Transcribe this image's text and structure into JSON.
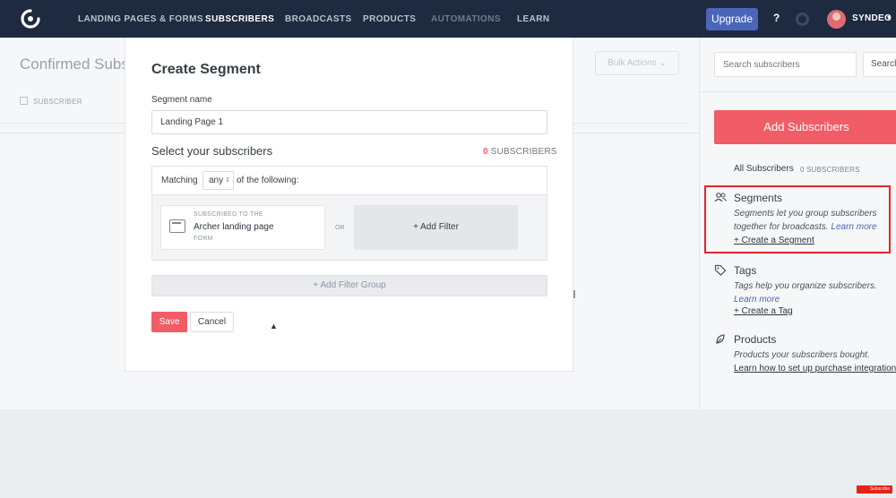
{
  "nav": {
    "items": [
      {
        "label": "LANDING PAGES & FORMS",
        "state": "normal"
      },
      {
        "label": "SUBSCRIBERS",
        "state": "active"
      },
      {
        "label": "BROADCASTS",
        "state": "normal"
      },
      {
        "label": "PRODUCTS",
        "state": "normal"
      },
      {
        "label": "AUTOMATIONS",
        "state": "dim"
      },
      {
        "label": "LEARN",
        "state": "normal"
      }
    ],
    "upgrade_label": "Upgrade",
    "help_label": "?",
    "user_name": "SYNDEO",
    "user_caret": "▾"
  },
  "page": {
    "title": "Confirmed Subs",
    "bulk_actions": "Bulk Actions ⌄",
    "column_subscriber": "SUBSCRIBER"
  },
  "sidebar": {
    "search_placeholder": "Search subscribers",
    "search_button": "Search",
    "add_subscribers": "Add Subscribers",
    "all_subscribers": "All Subscribers",
    "all_subscribers_count": "0 SUBSCRIBERS",
    "segments": {
      "title": "Segments",
      "desc": "Segments let you group subscribers together for broadcasts.",
      "learn_more": "Learn more",
      "link": "+ Create a Segment"
    },
    "tags": {
      "title": "Tags",
      "desc": "Tags help you organize subscribers.",
      "learn_more": "Learn more",
      "link": "+ Create a Tag"
    },
    "products": {
      "title": "Products",
      "desc": "Products your subscribers bought.",
      "link": "Learn how to set up purchase integrations"
    }
  },
  "modal": {
    "title": "Create Segment",
    "segment_name_label": "Segment name",
    "segment_name_value": "Landing Page 1",
    "select_title": "Select your subscribers",
    "count_number": "0",
    "count_label": "SUBSCRIBERS",
    "matching_label": "Matching",
    "matching_value": "any",
    "matching_suffix": "of the following:",
    "filter": {
      "pre": "SUBSCRIBED TO THE",
      "main": "Archer landing page",
      "post": "FORM"
    },
    "or_label": "OR",
    "add_filter": "+ Add Filter",
    "add_filter_group": "+ Add Filter Group",
    "save": "Save",
    "cancel": "Cancel"
  },
  "badge": {
    "label": "Subscribe"
  },
  "colors": {
    "nav_bg": "#1d2a3f",
    "accent_red": "#f05d66",
    "upgrade_blue": "#4a66b8",
    "highlight_box": "#e0262b"
  }
}
